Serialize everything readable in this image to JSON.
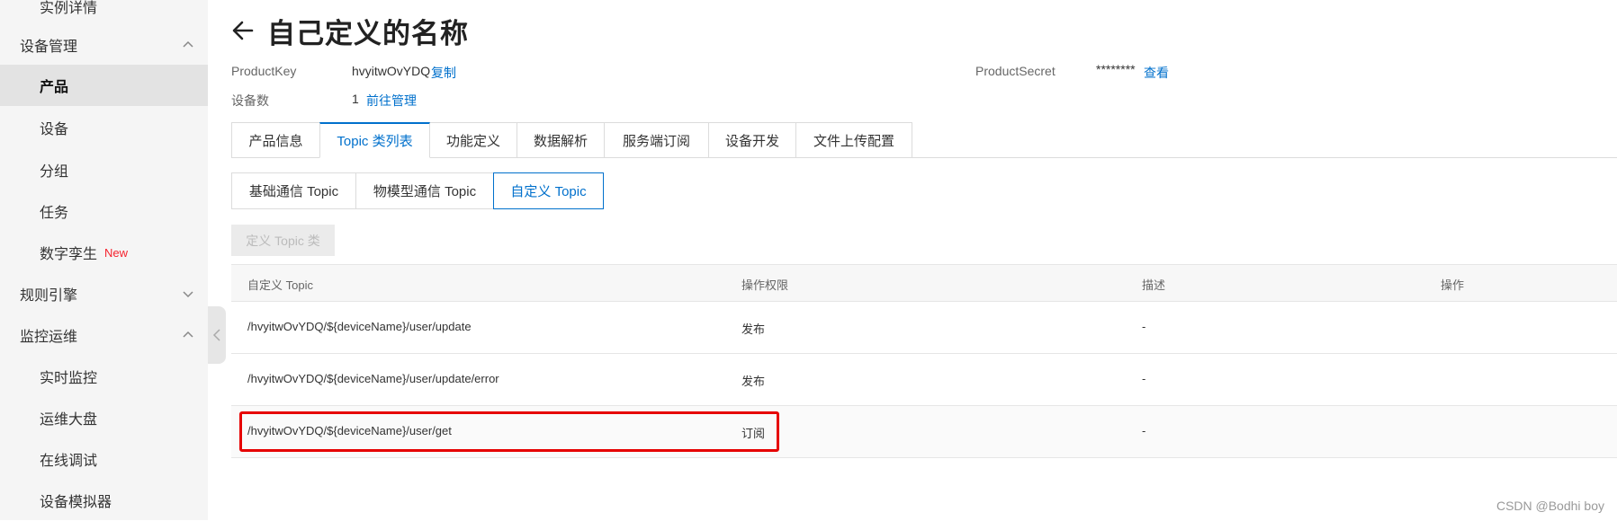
{
  "sidebar": {
    "items": [
      {
        "label": "实例详情",
        "type": "sub-top"
      },
      {
        "label": "设备管理",
        "type": "group",
        "chevron": "up"
      },
      {
        "label": "产品",
        "type": "sub",
        "active": true
      },
      {
        "label": "设备",
        "type": "sub"
      },
      {
        "label": "分组",
        "type": "sub"
      },
      {
        "label": "任务",
        "type": "sub"
      },
      {
        "label": "数字孪生",
        "type": "sub",
        "badge": "New"
      },
      {
        "label": "规则引擎",
        "type": "group",
        "chevron": "down"
      },
      {
        "label": "监控运维",
        "type": "group",
        "chevron": "up"
      },
      {
        "label": "实时监控",
        "type": "sub"
      },
      {
        "label": "运维大盘",
        "type": "sub"
      },
      {
        "label": "在线调试",
        "type": "sub"
      },
      {
        "label": "设备模拟器",
        "type": "sub"
      }
    ]
  },
  "header": {
    "title": "自己定义的名称",
    "product_key_label": "ProductKey",
    "product_key_value": "hvyitwOvYDQ",
    "copy_label": "复制",
    "device_count_label": "设备数",
    "device_count_value": "1",
    "manage_label": "前往管理",
    "product_secret_label": "ProductSecret",
    "product_secret_value": "********",
    "view_label": "查看"
  },
  "tabs": [
    {
      "label": "产品信息"
    },
    {
      "label": "Topic 类列表",
      "active": true
    },
    {
      "label": "功能定义"
    },
    {
      "label": "数据解析"
    },
    {
      "label": "服务端订阅"
    },
    {
      "label": "设备开发"
    },
    {
      "label": "文件上传配置"
    }
  ],
  "subtabs": [
    {
      "label": "基础通信 Topic"
    },
    {
      "label": "物模型通信 Topic"
    },
    {
      "label": "自定义 Topic",
      "active": true
    }
  ],
  "define_button_label": "定义 Topic 类",
  "table": {
    "columns": [
      "自定义 Topic",
      "操作权限",
      "描述",
      "操作"
    ],
    "rows": [
      {
        "topic": "/hvyitwOvYDQ/${deviceName}/user/update",
        "permission": "发布",
        "description": "-"
      },
      {
        "topic": "/hvyitwOvYDQ/${deviceName}/user/update/error",
        "permission": "发布",
        "description": "-"
      },
      {
        "topic": "/hvyitwOvYDQ/${deviceName}/user/get",
        "permission": "订阅",
        "description": "-"
      }
    ]
  },
  "watermark": "CSDN @Bodhi boy",
  "colors": {
    "accent": "#0070cc",
    "highlight": "#e60000",
    "new_badge": "#f5222d",
    "sidebar_bg": "#f5f5f5"
  },
  "icons": {
    "back": "arrow-left-icon",
    "collapse": "chevron-left-icon"
  }
}
